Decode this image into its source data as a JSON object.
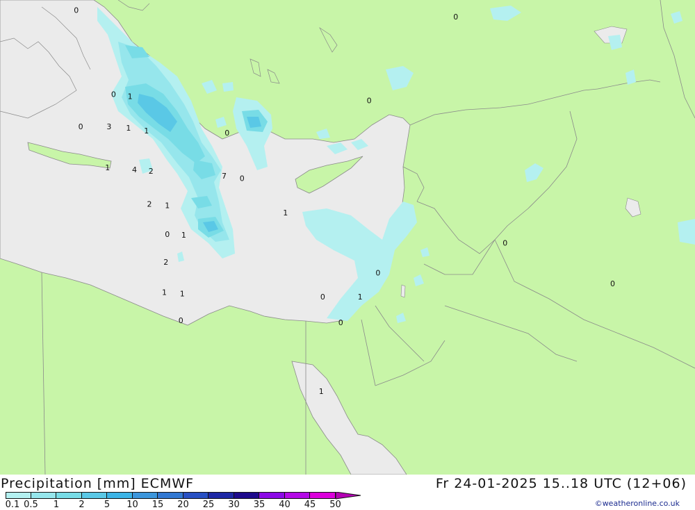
{
  "title": {
    "left": "Precipitation [mm] ECMWF",
    "right": "Fr 24-01-2025 15..18 UTC (12+06)"
  },
  "credit": "©weatheronline.co.uk",
  "colors": {
    "land": "#c8f5a8",
    "sea": "#ebebeb",
    "border": "#8a8a8a"
  },
  "scale": {
    "ticks": [
      "0.1",
      "0.5",
      "1",
      "2",
      "5",
      "10",
      "15",
      "20",
      "25",
      "30",
      "35",
      "40",
      "45",
      "50"
    ],
    "colors": [
      "#b4f0f0",
      "#96e6ec",
      "#78dce6",
      "#5ac8e6",
      "#3cb4e6",
      "#3c96dc",
      "#3278d2",
      "#2850c3",
      "#1e28a5",
      "#1e0a8c",
      "#8c0ae6",
      "#b40ae6",
      "#dc00dc",
      "#b400b4"
    ]
  },
  "precip_labels": [
    {
      "text": "0",
      "lon": 24.55,
      "lat": 41.15
    },
    {
      "text": "0",
      "lon": 25.8,
      "lat": 39.2
    },
    {
      "text": "1",
      "lon": 26.35,
      "lat": 39.15
    },
    {
      "text": "0",
      "lon": 24.7,
      "lat": 38.45
    },
    {
      "text": "3",
      "lon": 25.65,
      "lat": 38.45
    },
    {
      "text": "1",
      "lon": 26.3,
      "lat": 38.42
    },
    {
      "text": "1",
      "lon": 26.9,
      "lat": 38.35
    },
    {
      "text": "0",
      "lon": 29.6,
      "lat": 38.3
    },
    {
      "text": "1",
      "lon": 25.6,
      "lat": 37.5
    },
    {
      "text": "4",
      "lon": 26.5,
      "lat": 37.45
    },
    {
      "text": "2",
      "lon": 27.05,
      "lat": 37.42
    },
    {
      "text": "7",
      "lon": 29.5,
      "lat": 37.3
    },
    {
      "text": "0",
      "lon": 30.1,
      "lat": 37.25
    },
    {
      "text": "2",
      "lon": 27.0,
      "lat": 36.65
    },
    {
      "text": "1",
      "lon": 27.6,
      "lat": 36.62
    },
    {
      "text": "1",
      "lon": 31.55,
      "lat": 36.45
    },
    {
      "text": "0",
      "lon": 27.6,
      "lat": 35.95
    },
    {
      "text": "1",
      "lon": 28.15,
      "lat": 35.93
    },
    {
      "text": "2",
      "lon": 27.55,
      "lat": 35.3
    },
    {
      "text": "1",
      "lon": 27.5,
      "lat": 34.6
    },
    {
      "text": "1",
      "lon": 28.1,
      "lat": 34.57
    },
    {
      "text": "0",
      "lon": 28.05,
      "lat": 33.95
    },
    {
      "text": "0",
      "lon": 32.8,
      "lat": 34.5
    },
    {
      "text": "1",
      "lon": 34.05,
      "lat": 34.5
    },
    {
      "text": "0",
      "lon": 33.4,
      "lat": 33.9
    },
    {
      "text": "0",
      "lon": 34.65,
      "lat": 35.05
    },
    {
      "text": "1",
      "lon": 32.75,
      "lat": 32.3
    },
    {
      "text": "0",
      "lon": 38.9,
      "lat": 35.75
    },
    {
      "text": "0",
      "lon": 42.5,
      "lat": 34.8
    },
    {
      "text": "0",
      "lon": 34.35,
      "lat": 39.05
    },
    {
      "text": "0",
      "lon": 37.25,
      "lat": 41.0
    }
  ]
}
